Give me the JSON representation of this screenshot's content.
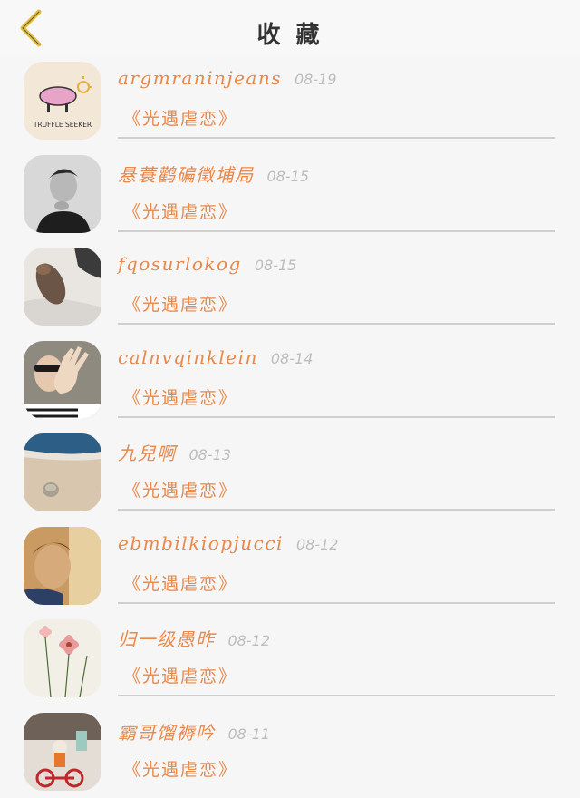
{
  "header": {
    "title": "收 藏",
    "back_icon": "chevron-left-icon"
  },
  "colors": {
    "accent": "#e8884a",
    "back": "#e2c040",
    "date": "#bdbdbd"
  },
  "items": [
    {
      "name": "argmraninjeans",
      "date": "08-19",
      "work": "《光遇虐恋》",
      "avatar": "avatar-pig-logo"
    },
    {
      "name": "悬蓑鹳碥徵埔局",
      "date": "08-15",
      "work": "《光遇虐恋》",
      "avatar": "avatar-man-portrait"
    },
    {
      "name": "fqosurlokog",
      "date": "08-15",
      "work": "《光遇虐恋》",
      "avatar": "avatar-cat-blanket"
    },
    {
      "name": "calnvqinklein",
      "date": "08-14",
      "work": "《光遇虐恋》",
      "avatar": "avatar-sunglasses-wave"
    },
    {
      "name": "九兒啊",
      "date": "08-13",
      "work": "《光遇虐恋》",
      "avatar": "avatar-beach-shell"
    },
    {
      "name": "ebmbilkiopjucci",
      "date": "08-12",
      "work": "《光遇虐恋》",
      "avatar": "avatar-warm-portrait"
    },
    {
      "name": "归一级愚昨",
      "date": "08-12",
      "work": "《光遇虐恋》",
      "avatar": "avatar-cosmos-flowers"
    },
    {
      "name": "霸哥馏褥吟",
      "date": "08-11",
      "work": "《光遇虐恋》",
      "avatar": "avatar-figure-bicycle"
    }
  ]
}
